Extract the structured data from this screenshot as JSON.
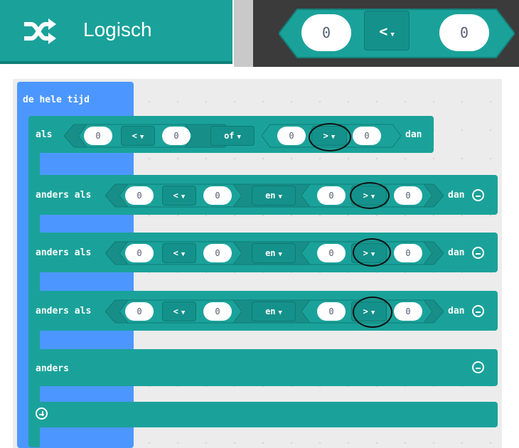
{
  "category": {
    "label": "Logisch",
    "icon": "shuffle-icon",
    "color": "#1aa29a"
  },
  "preview_block": {
    "left": "0",
    "op": "<",
    "right": "0"
  },
  "blocks": {
    "forever_label": "de hele tijd",
    "if_label": "als",
    "elseif_label": "anders als",
    "else_label": "anders",
    "then_label": "dan"
  },
  "conditions": [
    {
      "a": "0",
      "op1": "<",
      "b": "0",
      "join": "of",
      "c": "0",
      "op2": ">",
      "d": "0"
    },
    {
      "a": "0",
      "op1": "<",
      "b": "0",
      "join": "en",
      "c": "0",
      "op2": ">",
      "d": "0"
    },
    {
      "a": "0",
      "op1": "<",
      "b": "0",
      "join": "en",
      "c": "0",
      "op2": ">",
      "d": "0"
    },
    {
      "a": "0",
      "op1": "<",
      "b": "0",
      "join": "en",
      "c": "0",
      "op2": ">",
      "d": "0"
    }
  ],
  "colors": {
    "loops": "#4c97ff",
    "logic": "#1aa29a",
    "workspace": "#3b3b3b"
  }
}
